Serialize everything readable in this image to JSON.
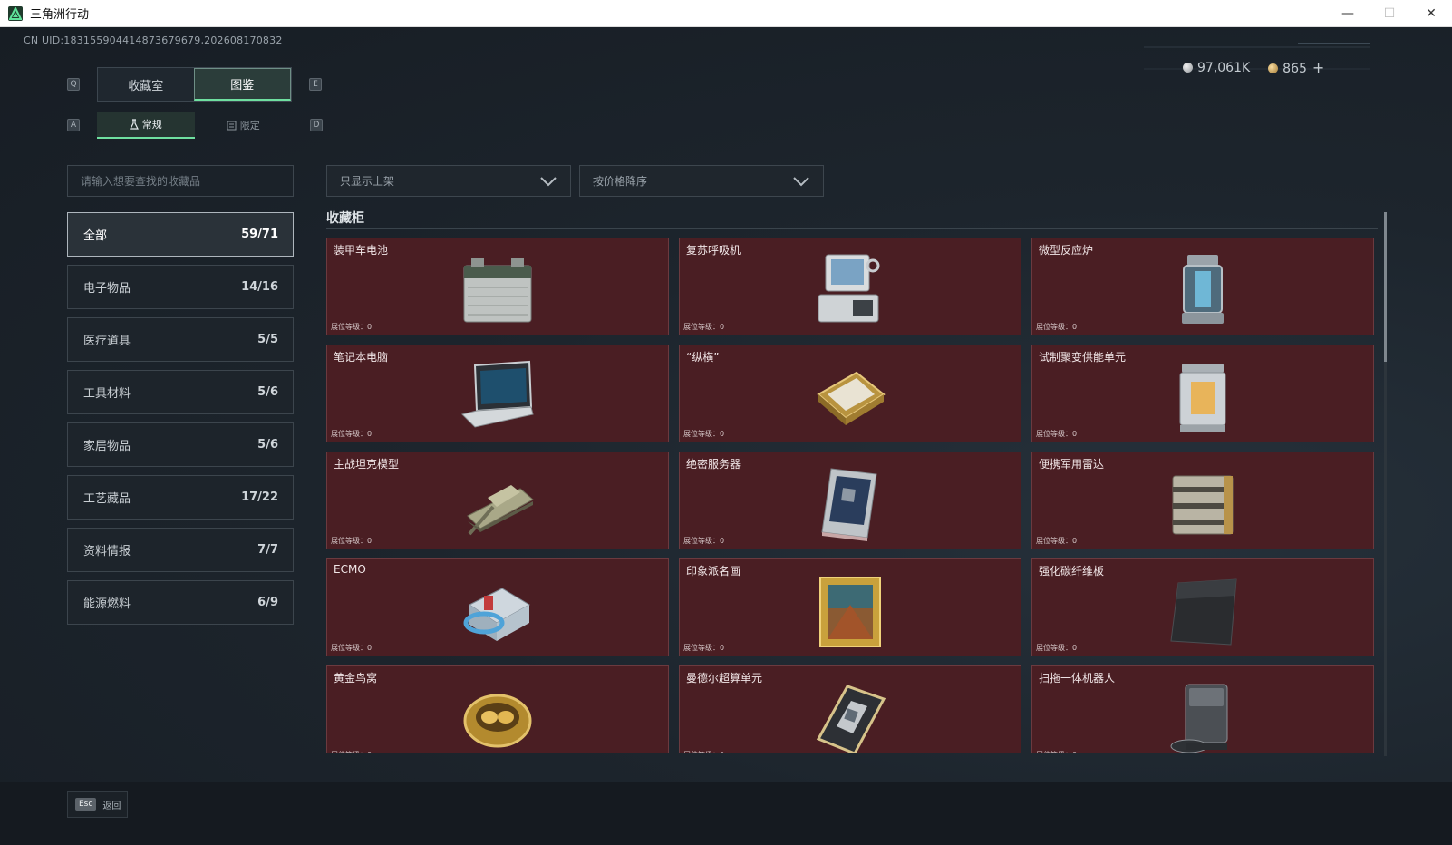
{
  "window": {
    "title": "三角洲行动"
  },
  "uid": "CN UID:1831559044148736796​79,202608170832",
  "currency": {
    "silver": "97,061K",
    "gold": "865",
    "plus": "+"
  },
  "keys": {
    "prev_tab": "Q",
    "next_tab": "E",
    "prev_sub": "A",
    "next_sub": "D"
  },
  "tabs": [
    {
      "label": "收藏室"
    },
    {
      "label": "图鉴"
    }
  ],
  "subtabs": [
    {
      "label": "常规"
    },
    {
      "label": "限定"
    }
  ],
  "search": {
    "placeholder": "请输入想要查找的收藏品"
  },
  "filters": {
    "shelf": "只显示上架",
    "sort": "按价格降序"
  },
  "categories": [
    {
      "label": "全部",
      "count": "59/71"
    },
    {
      "label": "电子物品",
      "count": "14/16"
    },
    {
      "label": "医疗道具",
      "count": "5/5"
    },
    {
      "label": "工具材料",
      "count": "5/6"
    },
    {
      "label": "家居物品",
      "count": "5/6"
    },
    {
      "label": "工艺藏品",
      "count": "17/22"
    },
    {
      "label": "资料情报",
      "count": "7/7"
    },
    {
      "label": "能源燃料",
      "count": "6/9"
    }
  ],
  "section": {
    "title": "收藏柜"
  },
  "level_label": "展位等级：0",
  "items": [
    {
      "name": "装甲车电池",
      "icon": "battery-icon"
    },
    {
      "name": "复苏呼吸机",
      "icon": "ventilator-icon"
    },
    {
      "name": "微型反应炉",
      "icon": "reactor-icon"
    },
    {
      "name": "笔记本电脑",
      "icon": "laptop-icon"
    },
    {
      "name": "“纵横”",
      "icon": "chessboard-icon"
    },
    {
      "name": "试制聚变供能单元",
      "icon": "fusion-cell-icon"
    },
    {
      "name": "主战坦克模型",
      "icon": "tank-icon"
    },
    {
      "name": "绝密服务器",
      "icon": "server-icon"
    },
    {
      "name": "便携军用雷达",
      "icon": "radar-icon"
    },
    {
      "name": "ECMO",
      "icon": "ecmo-icon"
    },
    {
      "name": "印象派名画",
      "icon": "painting-icon"
    },
    {
      "name": "强化碳纤维板",
      "icon": "carbon-plate-icon"
    },
    {
      "name": "黄金鸟窝",
      "icon": "golden-nest-icon"
    },
    {
      "name": "曼德尔超算单元",
      "icon": "compute-unit-icon"
    },
    {
      "name": "扫拖一体机器人",
      "icon": "robot-vacuum-icon"
    }
  ],
  "footer": {
    "esc_key": "Esc",
    "back_label": "返回"
  }
}
